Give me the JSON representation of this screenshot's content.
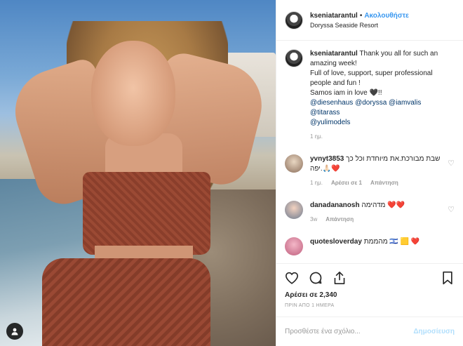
{
  "header": {
    "username": "kseniatarantul",
    "separator": "•",
    "follow_label": "Ακολουθήστε",
    "location": "Doryssa Seaside Resort"
  },
  "caption": {
    "username": "kseniatarantul",
    "line1": "Thank you all for such an amazing week!",
    "line2": "Full of love, support, super professional people and fun !",
    "line3": "Samos iam in love 🖤!!",
    "mentions": [
      "@diesenhaus",
      "@doryssa",
      "@iamvalis",
      "@titarass",
      "@yulimodels"
    ],
    "time": "1 ημ."
  },
  "comments": [
    {
      "username": "yvnyt3853",
      "text": "שבת מבורכת.את מיוחדת וכל כך יפה.🙏🏻❤️",
      "time": "1 ημ.",
      "likes": "Αρέσει σε 1",
      "reply": "Απάντηση"
    },
    {
      "username": "danadananosh",
      "text": "מדהימה ❤️❤️",
      "time": "3w",
      "reply": "Απάντηση"
    },
    {
      "username": "quotesloverday",
      "text": "מהממת 🇮🇱 🟨 ❤️"
    }
  ],
  "likes": "Αρέσει σε 2,340",
  "timestamp": "ΠΡΙΝ ΑΠΟ 1 ΗΜΕΡΑ",
  "add_comment": {
    "placeholder": "Προσθέστε ένα σχόλιο...",
    "post_label": "Δημοσίευση"
  }
}
